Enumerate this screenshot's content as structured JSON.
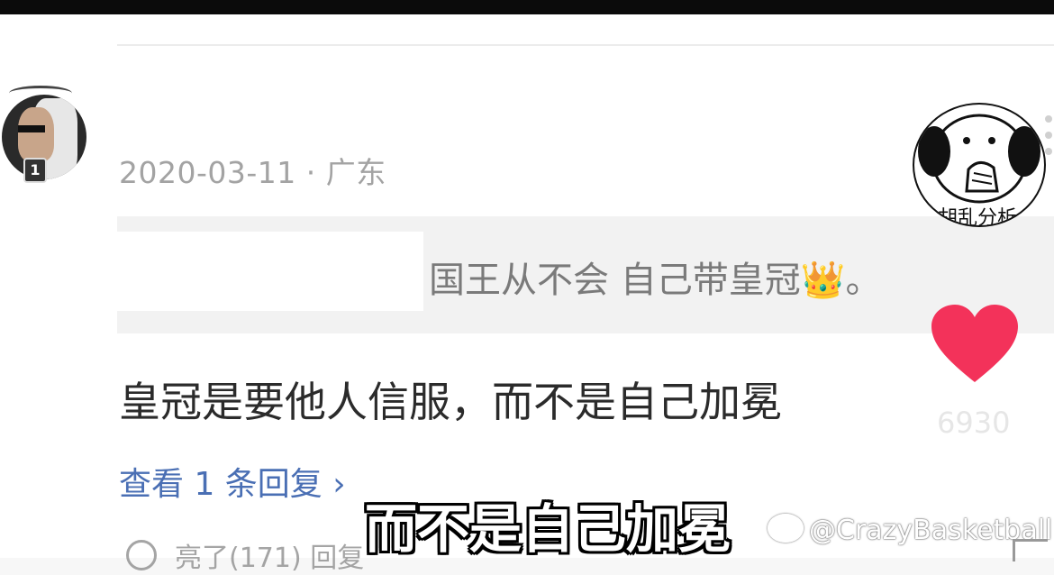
{
  "post": {
    "date_location": "2020-03-11 · 广东",
    "quote_text": "国王从不会 自己带皇冠",
    "quote_emoji": "👑",
    "quote_end": "。",
    "comment_text": "皇冠是要他人信服，而不是自己加冕",
    "replies_link": "查看 1 条回复 ›",
    "like_count": "6930",
    "bottom_actions": "亮了(171)          回复",
    "avatar_badge": "1"
  },
  "sticker": {
    "caption": "胡乱分析"
  },
  "video_overlay": {
    "subtitle": "而不是自己加冕",
    "watermark": "@CrazyBasketball"
  },
  "colors": {
    "like_heart": "#f3325a",
    "link": "#4a6fb4",
    "meta_text": "#a3a3a3"
  },
  "icons": [
    "heart-icon",
    "weibo-logo-icon",
    "clock-icon",
    "more-dots-icon"
  ]
}
